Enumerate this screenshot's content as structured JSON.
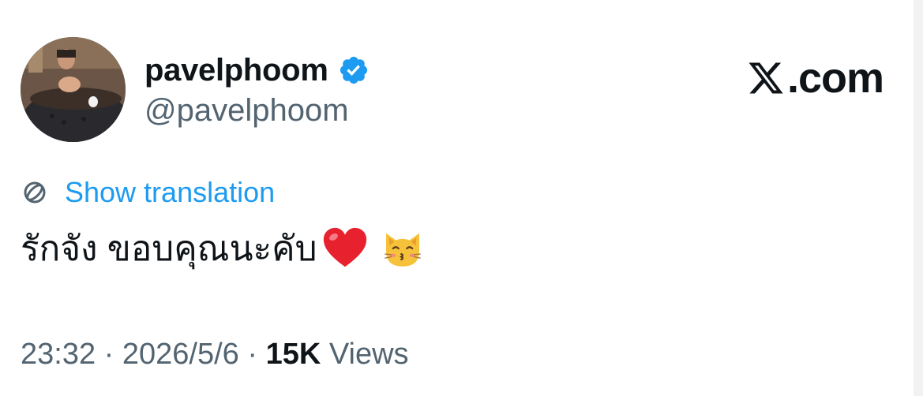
{
  "profile": {
    "display_name": "pavelphoom",
    "handle": "@pavelphoom",
    "verified": true
  },
  "brand": {
    "text": ".com"
  },
  "translation": {
    "label": "Show translation"
  },
  "tweet": {
    "text": "รักจัง ขอบคุณนะคับ",
    "emojis": [
      "heart-icon",
      "kissing-cat-icon"
    ]
  },
  "meta": {
    "time": "23:32",
    "separator": " · ",
    "date": "2026/5/6",
    "views_count": "15K",
    "views_label": " Views"
  },
  "colors": {
    "accent": "#1d9bf0",
    "text": "#0f1419",
    "secondary": "#536471",
    "heart": "#e8212f",
    "cat": "#f6c23b"
  }
}
